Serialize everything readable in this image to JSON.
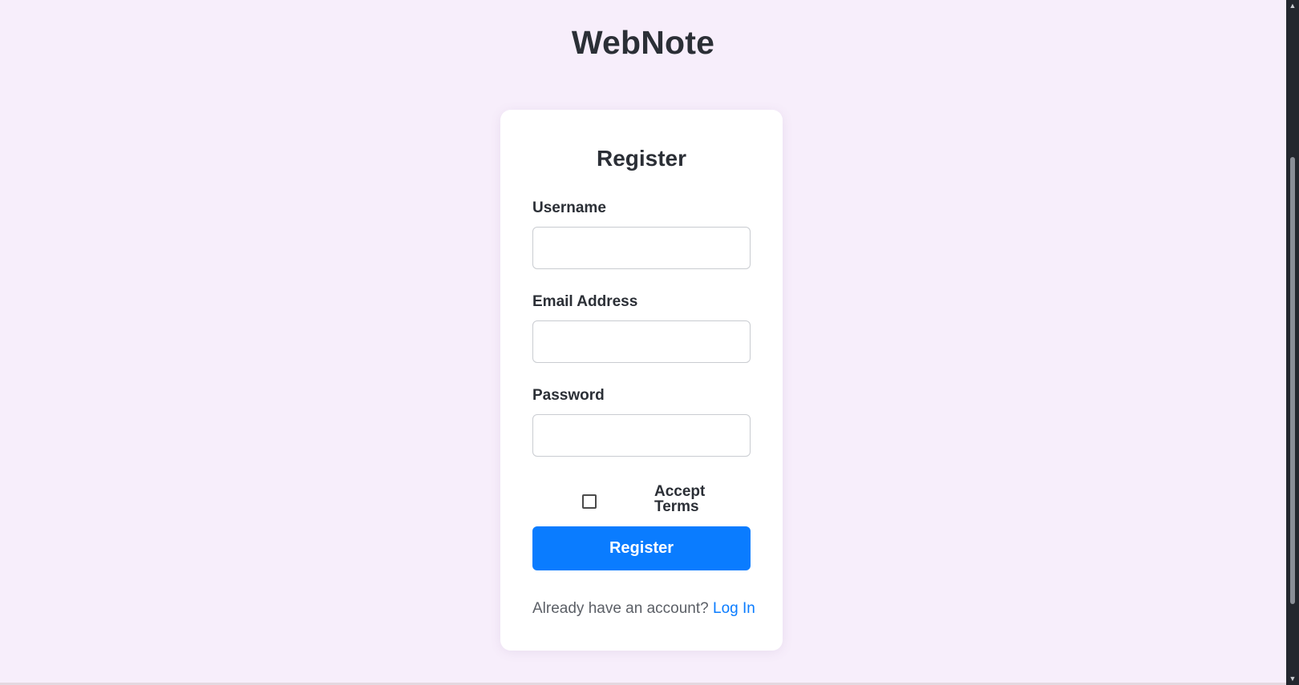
{
  "app": {
    "title": "WebNote"
  },
  "form": {
    "title": "Register",
    "username": {
      "label": "Username",
      "value": "",
      "placeholder": ""
    },
    "email": {
      "label": "Email Address",
      "value": "",
      "placeholder": ""
    },
    "password": {
      "label": "Password",
      "value": "",
      "placeholder": ""
    },
    "terms": {
      "label": "Accept Terms",
      "checked": false
    },
    "submit_label": "Register",
    "login_prompt": "Already have an account?",
    "login_link": "Log In"
  },
  "colors": {
    "background": "#f7eefb",
    "card": "#ffffff",
    "accent": "#0a7cff",
    "text": "#2b2f36"
  },
  "icons": {
    "scroll_up": "chevron-up-icon",
    "scroll_down": "chevron-down-icon"
  }
}
